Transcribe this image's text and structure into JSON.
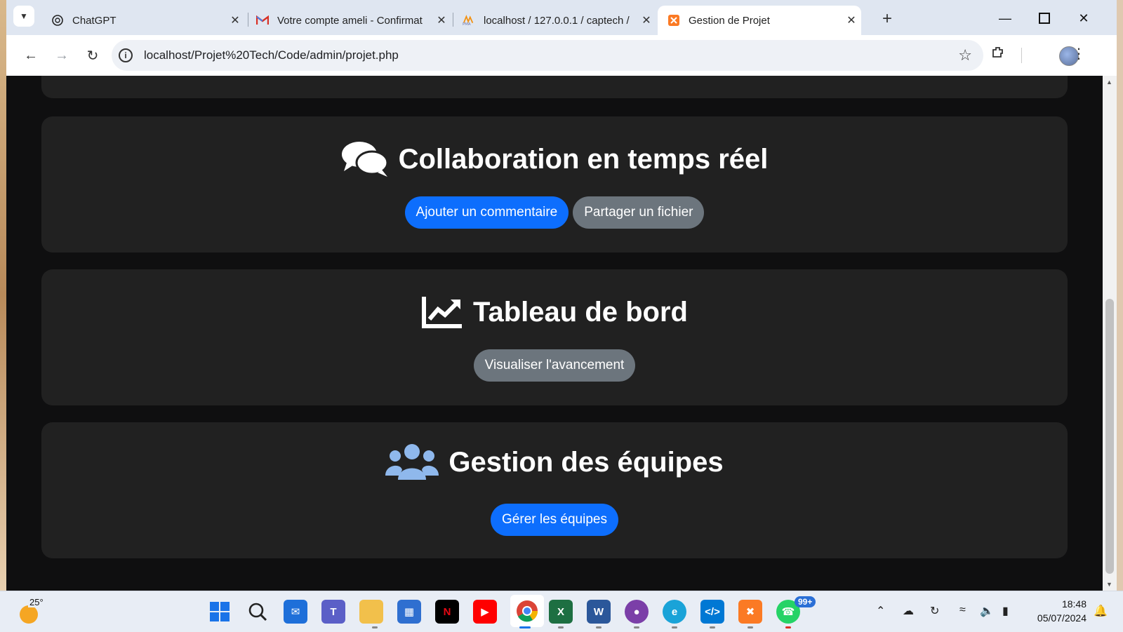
{
  "browser": {
    "tabs": [
      {
        "title": "ChatGPT",
        "favicon": "chatgpt-icon"
      },
      {
        "title": "Votre compte ameli - Confirmat",
        "favicon": "gmail-icon"
      },
      {
        "title": "localhost / 127.0.0.1 / captech /",
        "favicon": "phpmyadmin-icon"
      },
      {
        "title": "Gestion de Projet",
        "favicon": "xampp-icon",
        "active": true
      }
    ],
    "new_tab": "+",
    "url": "localhost/Projet%20Tech/Code/admin/projet.php"
  },
  "sections": {
    "collaboration": {
      "title": "Collaboration en temps réel",
      "icon": "comments-icon",
      "buttons": [
        "Ajouter un commentaire",
        "Partager un fichier"
      ]
    },
    "dashboard": {
      "title": "Tableau de bord",
      "icon": "chart-line-icon",
      "buttons": [
        "Visualiser l'avancement"
      ]
    },
    "teams": {
      "title": "Gestion des équipes",
      "icon": "users-icon",
      "buttons": [
        "Gérer les équipes"
      ]
    }
  },
  "taskbar": {
    "weather_temp": "25°",
    "whatsapp_badge": "99+",
    "time": "18:48",
    "date": "05/07/2024"
  },
  "colors": {
    "primary": "#0d6efd",
    "secondary": "#6c757d",
    "card": "#212121",
    "page_bg": "#0f0f10",
    "users_icon": "#8fb8ec"
  }
}
